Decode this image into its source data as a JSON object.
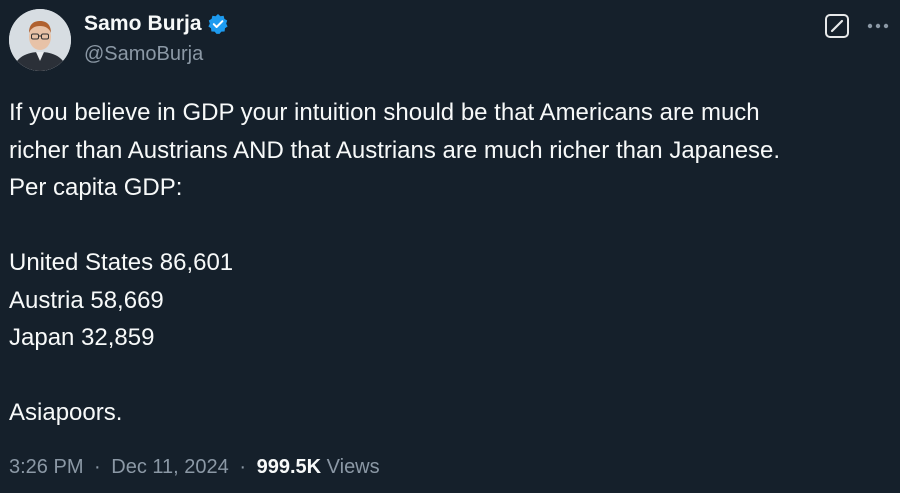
{
  "author": {
    "display_name": "Samo Burja",
    "handle": "@SamoBurja",
    "verified_icon": "verified-badge-icon",
    "verified_color": "#1d9bf0"
  },
  "actions": {
    "grok_icon": "grok-icon",
    "more_icon": "more-dots-icon"
  },
  "tweet": {
    "lines": [
      "If you believe in GDP your intuition should be that Americans are much",
      "richer than Austrians AND that Austrians are much richer than Japanese.",
      "Per capita GDP:",
      "",
      "United States 86,601",
      "Austria 58,669",
      "Japan 32,859",
      "",
      "Asiapoors."
    ]
  },
  "meta": {
    "time": "3:26 PM",
    "separator": "·",
    "date": "Dec 11, 2024",
    "views_count": "999.5K",
    "views_label": "Views"
  },
  "colors": {
    "background": "#15202b",
    "text_primary": "#f7f9f9",
    "text_secondary": "#8b98a5"
  }
}
